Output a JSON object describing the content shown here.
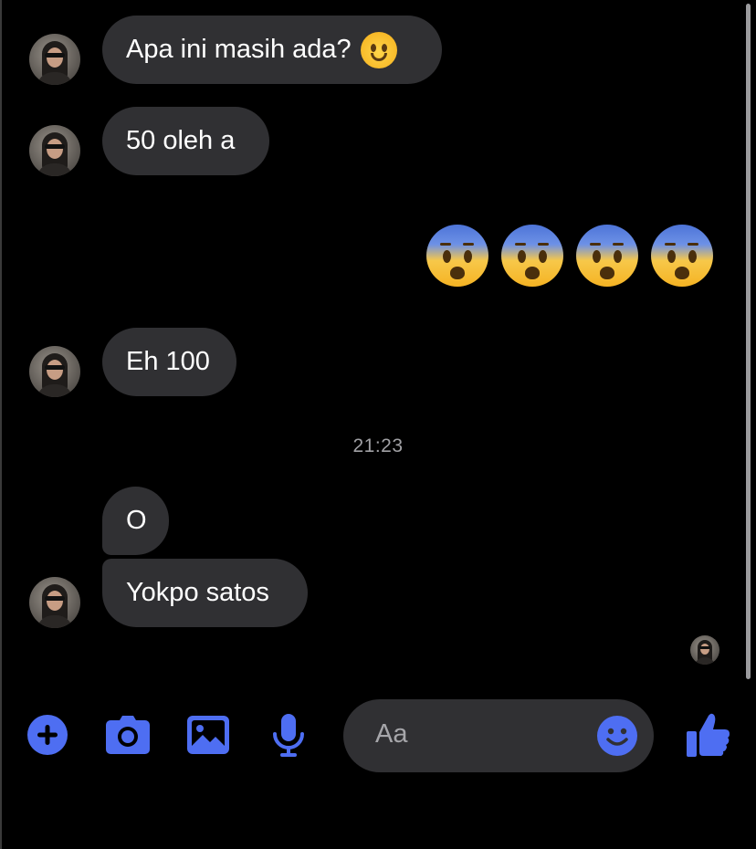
{
  "colors": {
    "accent": "#4e6ef2",
    "bubble": "#303033",
    "background": "#000000"
  },
  "messages": [
    {
      "text": "Apa ini masih ada?",
      "emoji": "smiling-face-icon"
    },
    {
      "text": "50 oleh a"
    },
    {
      "sent_emojis": [
        "fearful-face-icon",
        "fearful-face-icon",
        "fearful-face-icon",
        "fearful-face-icon"
      ]
    },
    {
      "text": "Eh 100"
    },
    {
      "text": "O"
    },
    {
      "text": "Yokpo satos"
    }
  ],
  "timestamp": "21:23",
  "composer": {
    "placeholder": "Aa",
    "icons": [
      "plus-circle-icon",
      "camera-icon",
      "image-icon",
      "microphone-icon",
      "emoji-icon",
      "thumbs-up-icon"
    ]
  }
}
